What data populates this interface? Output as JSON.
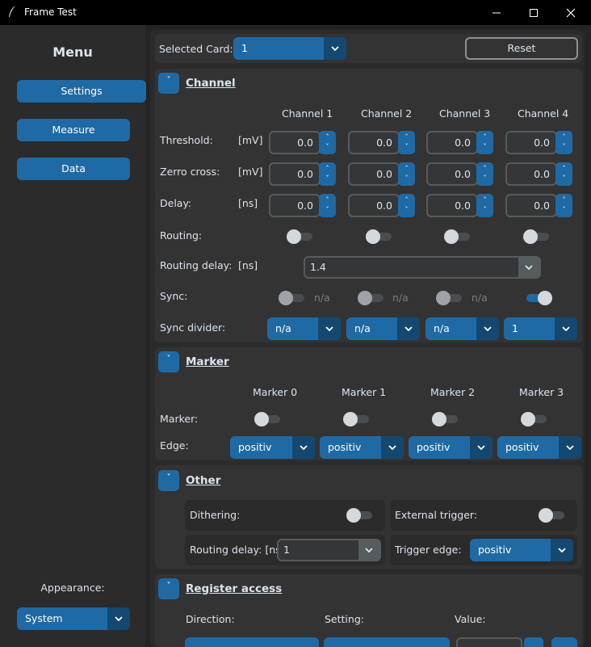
{
  "window": {
    "title": "Frame Test"
  },
  "sidebar": {
    "menu_title": "Menu",
    "buttons": [
      "Settings",
      "Measure",
      "Data"
    ],
    "appearance_label": "Appearance:",
    "appearance_value": "System"
  },
  "top": {
    "selected_card_label": "Selected Card:",
    "selected_card_value": "1",
    "reset_label": "Reset"
  },
  "channel": {
    "title": "Channel",
    "toggle_glyph": "˅",
    "columns": [
      "Channel 1",
      "Channel 2",
      "Channel 3",
      "Channel 4"
    ],
    "rows": [
      {
        "label": "Threshold:",
        "unit": "[mV]",
        "values": [
          "0.0",
          "0.0",
          "0.0",
          "0.0"
        ]
      },
      {
        "label": "Zerro cross:",
        "unit": "[mV]",
        "values": [
          "0.0",
          "0.0",
          "0.0",
          "0.0"
        ]
      },
      {
        "label": "Delay:",
        "unit": "[ns]",
        "values": [
          "0.0",
          "0.0",
          "0.0",
          "0.0"
        ]
      }
    ],
    "routing_label": "Routing:",
    "routing_states": [
      false,
      false,
      false,
      false
    ],
    "routing_delay_label": "Routing delay:",
    "routing_delay_unit": "[ns]",
    "routing_delay_value": "1.4",
    "sync_label": "Sync:",
    "sync_states": [
      false,
      false,
      false,
      true
    ],
    "sync_na": [
      "n/a",
      "n/a",
      "n/a"
    ],
    "sync_divider_label": "Sync divider:",
    "sync_divider_values": [
      "n/a",
      "n/a",
      "n/a",
      "1"
    ]
  },
  "marker": {
    "title": "Marker",
    "columns": [
      "Marker 0",
      "Marker 1",
      "Marker 2",
      "Marker 3"
    ],
    "marker_label": "Marker:",
    "marker_states": [
      false,
      false,
      false,
      false
    ],
    "edge_label": "Edge:",
    "edge_values": [
      "positiv",
      "positiv",
      "positiv",
      "positiv"
    ]
  },
  "other": {
    "title": "Other",
    "dithering_label": "Dithering:",
    "dithering_state": false,
    "external_trigger_label": "External trigger:",
    "external_trigger_state": false,
    "routing_delay_label": "Routing delay: [ns]",
    "routing_delay_value": "1",
    "trigger_edge_label": "Trigger edge:",
    "trigger_edge_value": "positiv"
  },
  "register": {
    "title": "Register access",
    "direction_label": "Direction:",
    "setting_label": "Setting:",
    "value_label": "Value:"
  },
  "colors": {
    "accent": "#1f6aa5",
    "accent_dark": "#144870",
    "frame": "#333333",
    "bg": "#2b2b2b"
  },
  "icons": [
    "feather-icon",
    "minimize-icon",
    "maximize-icon",
    "close-icon",
    "chevron-down-icon",
    "spin-up-icon",
    "spin-down-icon"
  ]
}
